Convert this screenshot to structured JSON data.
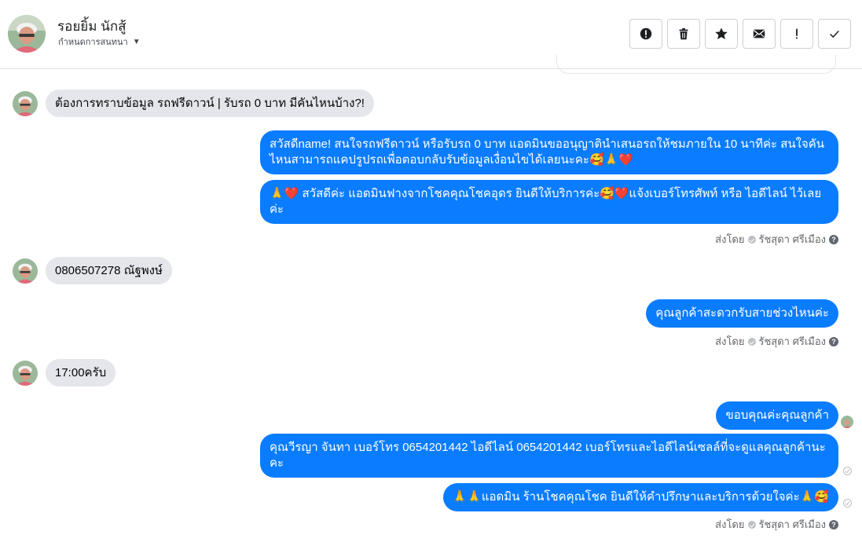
{
  "header": {
    "contact_name": "รอยยิ้ม นักสู้",
    "assign_label": "กำหนดการสนทนา"
  },
  "toolbar": {
    "buttons": [
      {
        "icon": "alert-circle-icon"
      },
      {
        "icon": "trash-icon"
      },
      {
        "icon": "star-icon"
      },
      {
        "icon": "mail-icon"
      },
      {
        "icon": "exclamation-icon"
      },
      {
        "icon": "checkmark-icon"
      }
    ]
  },
  "messages": {
    "in_1": "ต้องการทราบข้อมูล รถฟรีดาวน์ | รับรถ 0 บาท มีคันไหนบ้าง?!",
    "out_1": "สวัสดีname! สนใจรถฟรีดาวน์ หรือรับรถ 0 บาท แอดมินขออนุญาตินำเสนอรถให้ชมภายใน 10 นาทีค่ะ สนใจคันไหนสามารถแคปรูปรถเพื่อตอบกลับรับข้อมูลเงื่อนไขได้เลยนะคะ🥰🙏❤️",
    "out_2": "🙏❤️ สวัสดีค่ะ แอดมินฟางจากโชคคุณโชคอุดร ยินดีให้บริการค่ะ🥰❤️แจ้งเบอร์โทรศัพท์ หรือ ไอดีไลน์  ไว้เลยค่ะ",
    "in_2": "0806507278 ณัฐพงษ์",
    "out_3": "คุณลูกค้าสะดวกรับสายช่วงไหนค่ะ",
    "in_3": "17:00ครับ",
    "out_4": "ขอบคุณค่ะคุณลูกค้า",
    "out_5": "คุณวีรญา จันทา      เบอร์โทร 0654201442  ไอดีไลน์ 0654201442   เบอร์โทรและไอดีไลน์เซลล์ที่จะดูแลคุณลูกค้านะคะ",
    "out_6": "🙏🙏แอดมิน ร้านโชคคุณโชค ยินดีให้คำปรึกษาและบริการด้วยใจค่ะ🙏🥰"
  },
  "sent_by": {
    "label": "ส่งโดย",
    "agent": "รัชสุดา ศรีเมือง"
  },
  "colors": {
    "outgoing_bubble": "#0a7cff",
    "incoming_bubble": "#e4e6eb"
  }
}
